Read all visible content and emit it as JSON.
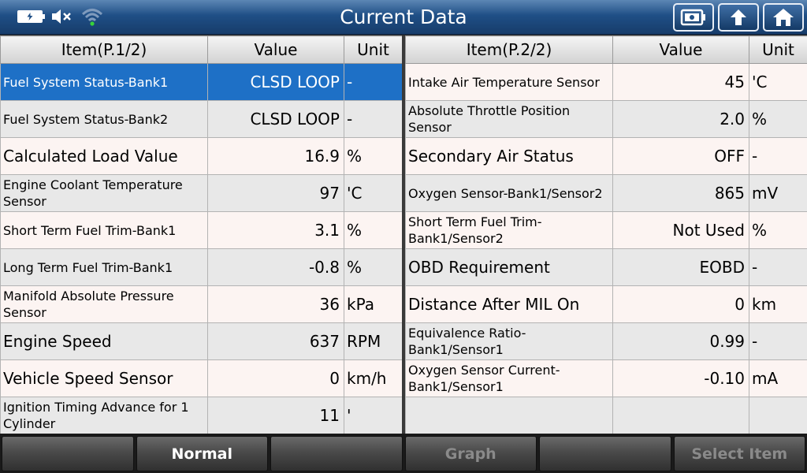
{
  "header": {
    "title": "Current Data",
    "status_icons": [
      "battery-charging-icon",
      "speaker-muted-icon",
      "wifi-icon"
    ],
    "toolbar_icons": [
      "save-screen-icon",
      "back-icon",
      "home-icon"
    ]
  },
  "left_table": {
    "headers": {
      "item": "Item(P.1/2)",
      "value": "Value",
      "unit": "Unit"
    },
    "rows": [
      {
        "item": "Fuel System Status-Bank1",
        "value": "CLSD LOOP",
        "unit": "-"
      },
      {
        "item": "Fuel System Status-Bank2",
        "value": "CLSD LOOP",
        "unit": "-"
      },
      {
        "item": "Calculated Load Value",
        "value": "16.9",
        "unit": "%"
      },
      {
        "item": "Engine Coolant Temperature Sensor",
        "value": "97",
        "unit": "'C"
      },
      {
        "item": "Short Term Fuel Trim-Bank1",
        "value": "3.1",
        "unit": "%"
      },
      {
        "item": "Long Term Fuel Trim-Bank1",
        "value": "-0.8",
        "unit": "%"
      },
      {
        "item": "Manifold Absolute Pressure Sensor",
        "value": "36",
        "unit": "kPa"
      },
      {
        "item": "Engine Speed",
        "value": "637",
        "unit": "RPM"
      },
      {
        "item": "Vehicle Speed Sensor",
        "value": "0",
        "unit": "km/h"
      },
      {
        "item": "Ignition Timing Advance for 1 Cylinder",
        "value": "11",
        "unit": "'"
      }
    ]
  },
  "right_table": {
    "headers": {
      "item": "Item(P.2/2)",
      "value": "Value",
      "unit": "Unit"
    },
    "rows": [
      {
        "item": "Intake Air Temperature Sensor",
        "value": "45",
        "unit": "'C"
      },
      {
        "item": "Absolute Throttle Position Sensor",
        "value": "2.0",
        "unit": "%"
      },
      {
        "item": "Secondary Air Status",
        "value": "OFF",
        "unit": "-"
      },
      {
        "item": "Oxygen Sensor-Bank1/Sensor2",
        "value": "865",
        "unit": "mV"
      },
      {
        "item": "Short Term Fuel Trim-Bank1/Sensor2",
        "value": "Not Used",
        "unit": "%"
      },
      {
        "item": "OBD Requirement",
        "value": "EOBD",
        "unit": "-"
      },
      {
        "item": "Distance After MIL On",
        "value": "0",
        "unit": "km"
      },
      {
        "item": "Equivalence Ratio-Bank1/Sensor1",
        "value": "0.99",
        "unit": "-"
      },
      {
        "item": "Oxygen Sensor Current-Bank1/Sensor1",
        "value": "-0.10",
        "unit": "mA"
      },
      {
        "item": "",
        "value": "",
        "unit": ""
      }
    ]
  },
  "bottom_bar": {
    "buttons": [
      "",
      "Normal",
      "",
      "Graph",
      "",
      "Select Item"
    ]
  },
  "colors": {
    "titlebar": "#1f4f86",
    "selected_row": "#1e70c6",
    "row_odd": "#fcf4f2",
    "row_even": "#e8e8e8"
  }
}
